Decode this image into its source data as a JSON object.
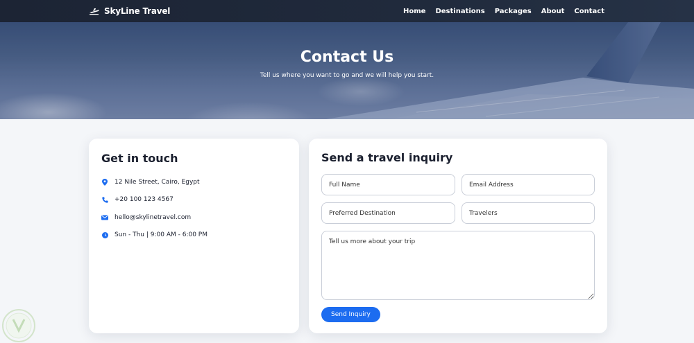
{
  "brand": {
    "name": "SkyLine Travel",
    "icon": "airplane-icon"
  },
  "nav": {
    "links": [
      {
        "label": "Home"
      },
      {
        "label": "Destinations"
      },
      {
        "label": "Packages"
      },
      {
        "label": "About"
      },
      {
        "label": "Contact"
      }
    ]
  },
  "hero": {
    "title": "Contact Us",
    "subtitle": "Tell us where you want to go and we will help you start."
  },
  "contact_info": {
    "title": "Get in touch",
    "items": [
      {
        "icon": "map-pin-icon",
        "text": "12 Nile Street, Cairo, Egypt"
      },
      {
        "icon": "phone-icon",
        "text": "+20 100 123 4567"
      },
      {
        "icon": "envelope-icon",
        "text": "hello@skylinetravel.com"
      },
      {
        "icon": "clock-icon",
        "text": "Sun - Thu | 9:00 AM - 6:00 PM"
      }
    ]
  },
  "inquiry_form": {
    "title": "Send a travel inquiry",
    "full_name_placeholder": "Full Name",
    "email_placeholder": "Email Address",
    "destination_placeholder": "Preferred Destination",
    "travelers_placeholder": "Travelers",
    "message_placeholder": "Tell us more about your trip",
    "submit_label": "Send Inquiry"
  },
  "colors": {
    "navbar": "#1c2434",
    "accent": "#1c6cf0",
    "icon": "#1c6cf0"
  }
}
